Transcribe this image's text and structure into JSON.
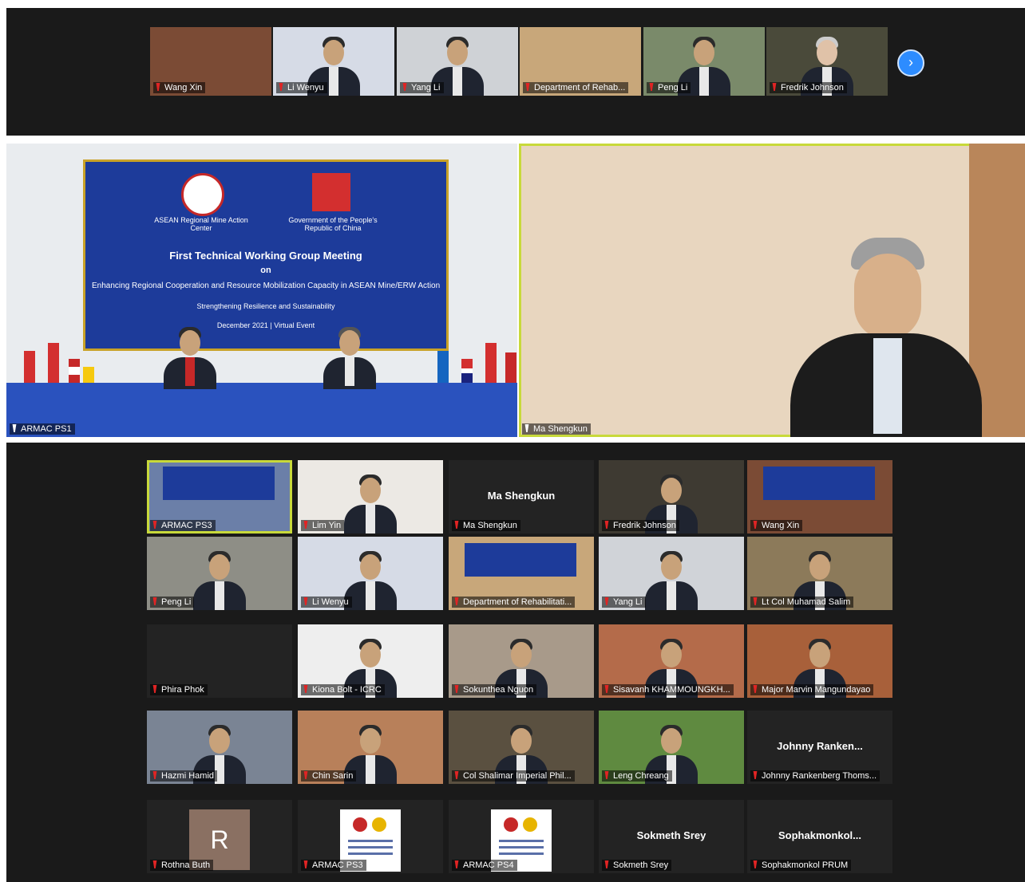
{
  "top_strip": {
    "tiles": [
      {
        "label": "Wang Xin"
      },
      {
        "label": "Li Wenyu"
      },
      {
        "label": "Yang Li"
      },
      {
        "label": "Department of Rehab..."
      },
      {
        "label": "Peng Li"
      },
      {
        "label": "Fredrik Johnson"
      }
    ],
    "next_icon": "›"
  },
  "main_video": {
    "left_label": "ARMAC PS1",
    "right_label": "Ma Shengkun",
    "banner": {
      "left_org": "ASEAN Regional Mine Action Center",
      "right_org": "Government of the People's Republic of China",
      "title": "First Technical Working Group Meeting",
      "on": "on",
      "subtitle": "Enhancing Regional Cooperation and Resource Mobilization Capacity in ASEAN Mine/ERW Action",
      "theme": "Strengthening Resilience and Sustainability",
      "date": "December 2021 | Virtual Event"
    }
  },
  "gallery": [
    {
      "label": "ARMAC PS3",
      "kind": "room"
    },
    {
      "label": "Lim Yin",
      "kind": "person"
    },
    {
      "label": "Ma Shengkun",
      "kind": "name",
      "center": "Ma Shengkun"
    },
    {
      "label": "Fredrik Johnson",
      "kind": "person"
    },
    {
      "label": "Wang Xin",
      "kind": "room"
    },
    {
      "label": "Peng Li",
      "kind": "person"
    },
    {
      "label": "Li Wenyu",
      "kind": "person"
    },
    {
      "label": "Department of Rehabilitati...",
      "kind": "room"
    },
    {
      "label": "Yang Li",
      "kind": "person"
    },
    {
      "label": "Lt Col Muhamad Salim",
      "kind": "person"
    },
    {
      "label": "Phira Phok",
      "kind": "blank"
    },
    {
      "label": "Kiona Bolt - ICRC",
      "kind": "person"
    },
    {
      "label": "Sokunthea Nguon",
      "kind": "person"
    },
    {
      "label": "Sisavanh KHAMMOUNGKH...",
      "kind": "person"
    },
    {
      "label": "Major Marvin Mangundayao",
      "kind": "person"
    },
    {
      "label": "Hazmi Hamid",
      "kind": "person"
    },
    {
      "label": "Chin Sarin",
      "kind": "person"
    },
    {
      "label": "Col Shalimar Imperial Phil...",
      "kind": "person"
    },
    {
      "label": "Leng Chreang",
      "kind": "person"
    },
    {
      "label": "Johnny Rankenberg Thoms...",
      "kind": "name",
      "center": "Johnny  Ranken..."
    },
    {
      "label": "Rothna Buth",
      "kind": "avatar",
      "center": "R"
    },
    {
      "label": "ARMAC PS3",
      "kind": "logo"
    },
    {
      "label": "ARMAC PS4",
      "kind": "logo"
    },
    {
      "label": "Sokmeth Srey",
      "kind": "name",
      "center": "Sokmeth Srey"
    },
    {
      "label": "Sophakmonkol PRUM",
      "kind": "name",
      "center": "Sophakmonkol..."
    }
  ]
}
